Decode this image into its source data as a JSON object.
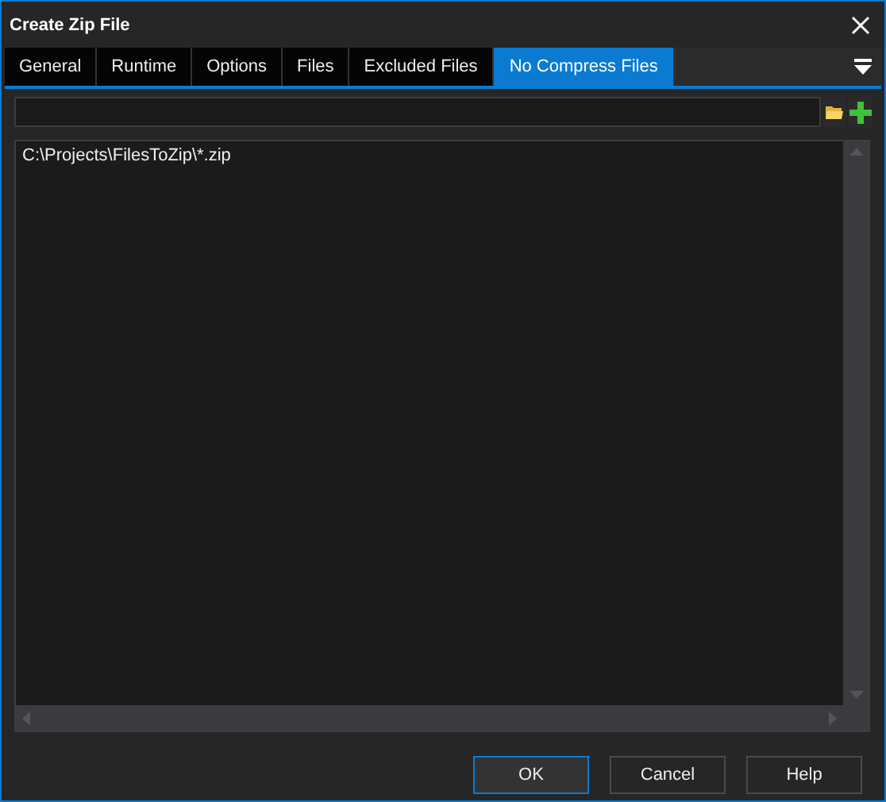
{
  "window": {
    "title": "Create Zip File"
  },
  "tabs": [
    {
      "label": "General",
      "selected": false
    },
    {
      "label": "Runtime",
      "selected": false
    },
    {
      "label": "Options",
      "selected": false
    },
    {
      "label": "Files",
      "selected": false
    },
    {
      "label": "Excluded Files",
      "selected": false
    },
    {
      "label": "No Compress Files",
      "selected": true
    }
  ],
  "list": {
    "items": [
      "C:\\Projects\\FilesToZip\\*.zip"
    ]
  },
  "buttons": [
    {
      "label": "OK",
      "default": true
    },
    {
      "label": "Cancel",
      "default": false
    },
    {
      "label": "Help",
      "default": false
    }
  ]
}
